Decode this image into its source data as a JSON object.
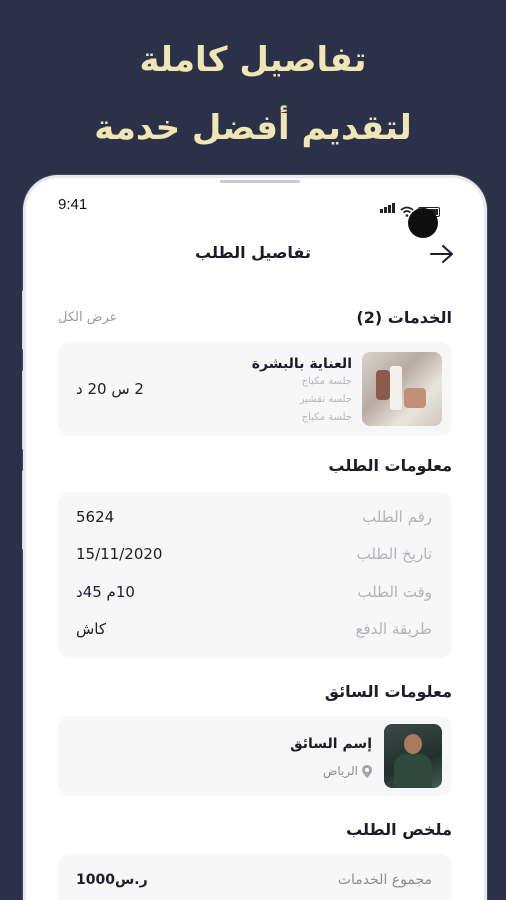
{
  "promo": {
    "line1": "تفاصيل كاملة",
    "line2": "لتقديم أفضل خدمة"
  },
  "status_bar": {
    "time": "9:41"
  },
  "header": {
    "title": "تفاصيل الطلب",
    "back_icon": "arrow-right-icon"
  },
  "services": {
    "title": "الخدمات (2)",
    "view_all": "عرض الكل",
    "item": {
      "name": "العناية بالبشرة",
      "sub": [
        "جلسة مكياج",
        "جلسة تقشير",
        "جلسة مكياج"
      ],
      "duration": "2 س 20 د"
    }
  },
  "order_info": {
    "title": "معلومات الطلب",
    "rows": [
      {
        "label": "رقم الطلب",
        "value": "5624"
      },
      {
        "label": "تاريخ الطلب",
        "value": "15/11/2020"
      },
      {
        "label": "وقت الطلب",
        "value": "10م 45د"
      },
      {
        "label": "طريقة الدفع",
        "value": "كاش"
      }
    ]
  },
  "driver_info": {
    "title": "معلومات السائق",
    "name": "إسم السائق",
    "city": "الرياض"
  },
  "summary": {
    "title": "ملخص الطلب",
    "rows": [
      {
        "label": "مجموع الخدمات",
        "value": "1000ر.س"
      }
    ]
  },
  "colors": {
    "background": "#2b3148",
    "headline": "#efe6b4",
    "card": "#f7f7f7"
  }
}
